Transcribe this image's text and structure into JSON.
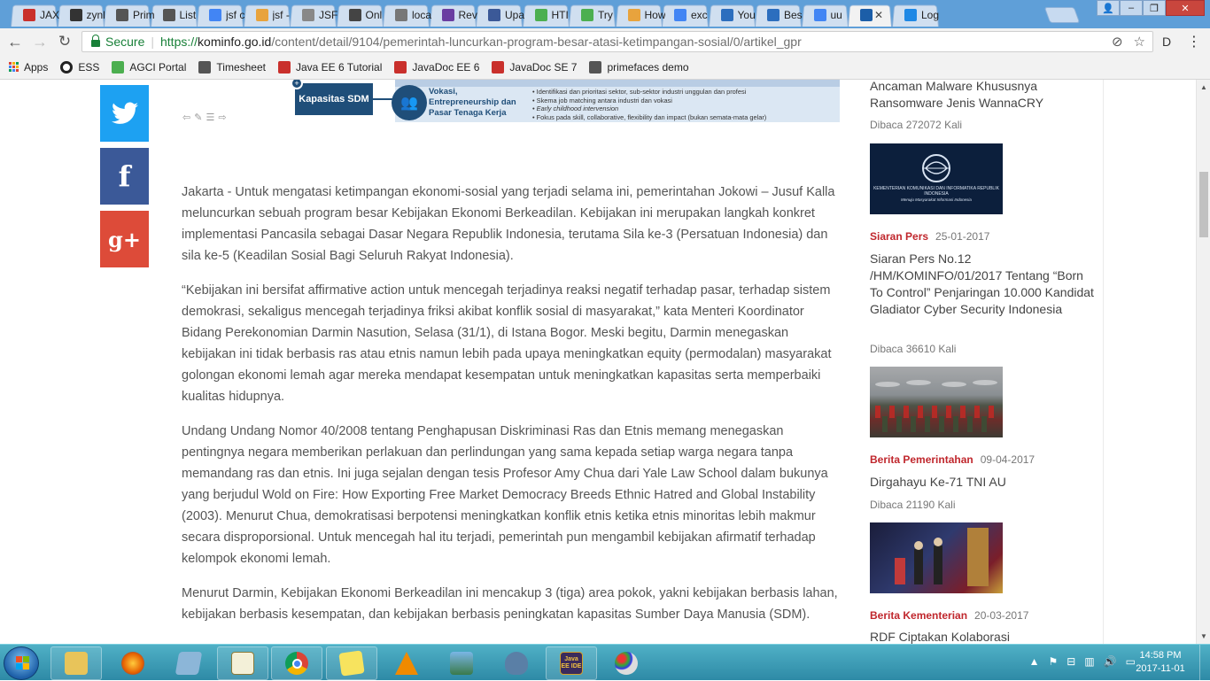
{
  "browser": {
    "tabs": [
      {
        "title": "JAX",
        "fav_color": "#c9302c",
        "icon": "oracle-icon"
      },
      {
        "title": "zynl",
        "fav_color": "#333333",
        "icon": "github-icon"
      },
      {
        "title": "Prim",
        "fav_color": "#555555",
        "icon": "primefaces-icon"
      },
      {
        "title": "List",
        "fav_color": "#555555",
        "icon": "wikipedia-icon"
      },
      {
        "title": "jsf c",
        "fav_color": "#4285f4",
        "icon": "google-icon"
      },
      {
        "title": "jsf -",
        "fav_color": "#e8a33d",
        "icon": "stackoverflow-icon"
      },
      {
        "title": "JSF",
        "fav_color": "#888888",
        "icon": "page-icon"
      },
      {
        "title": "Onl",
        "fav_color": "#444444",
        "icon": "mascot-icon"
      },
      {
        "title": "loca",
        "fav_color": "#777777",
        "icon": "document-icon"
      },
      {
        "title": "Rev",
        "fav_color": "#6a3ea1",
        "icon": "d-icon"
      },
      {
        "title": "Upa",
        "fav_color": "#3b5998",
        "icon": "facebook-icon"
      },
      {
        "title": "HTI",
        "fav_color": "#4caf50",
        "icon": "w3schools-icon"
      },
      {
        "title": "Try",
        "fav_color": "#4caf50",
        "icon": "w3schools-icon"
      },
      {
        "title": "How",
        "fav_color": "#e8a33d",
        "icon": "stackoverflow-icon"
      },
      {
        "title": "exc",
        "fav_color": "#4285f4",
        "icon": "google-icon"
      },
      {
        "title": "You",
        "fav_color": "#2c6ebe",
        "icon": "grid-icon"
      },
      {
        "title": "Bes",
        "fav_color": "#2c6ebe",
        "icon": "cb-icon"
      },
      {
        "title": "uu",
        "fav_color": "#4285f4",
        "icon": "google-icon"
      },
      {
        "title": "",
        "fav_color": "#1c5ea8",
        "icon": "kominfo-icon",
        "active": true
      },
      {
        "title": "Log",
        "fav_color": "#1e88e5",
        "icon": "r-icon"
      }
    ],
    "active_tab_close": "✕",
    "url": {
      "secure_label": "Secure",
      "scheme": "https://",
      "host": "kominfo.go.id",
      "path": "/content/detail/9104/pemerintah-luncurkan-program-besar-atasi-ketimpangan-sosial/0/artikel_gpr"
    },
    "bookmarks": [
      {
        "label": "Apps",
        "icon": "apps-grid-icon",
        "color": "#555555"
      },
      {
        "label": "ESS",
        "icon": "ess-icon",
        "color": "#222222"
      },
      {
        "label": "AGCI Portal",
        "icon": "agci-icon",
        "color": "#4caf50"
      },
      {
        "label": "Timesheet",
        "icon": "timesheet-icon",
        "color": "#555555"
      },
      {
        "label": "Java EE 6 Tutorial",
        "icon": "oracle-icon",
        "color": "#c9302c"
      },
      {
        "label": "JavaDoc EE 6",
        "icon": "oracle-icon",
        "color": "#c9302c"
      },
      {
        "label": "JavaDoc SE 7",
        "icon": "oracle-icon",
        "color": "#c9302c"
      },
      {
        "label": "primefaces demo",
        "icon": "primefaces-icon",
        "color": "#555555"
      }
    ]
  },
  "page": {
    "infographic": {
      "box_label": "Kapasitas SDM",
      "pillar_label": "Vokasi, Entrepreneurship dan Pasar Tenaga Kerja",
      "bullets": [
        "Identifikasi dan prioritasi sektor, sub-sektor industri unggulan dan profesi",
        "Skema job matching antara industri dan vokasi",
        "Early childhood intervension",
        "Fokus pada skill, collaborative, flexibility dan impact (bukan semata-mata gelar)"
      ]
    },
    "share": {
      "colors": {
        "twitter": "#1da1f2",
        "facebook": "#3b5998",
        "googleplus": "#dd4b39"
      },
      "gplus_text": "g+"
    },
    "article": {
      "paragraphs": [
        "Jakarta - Untuk mengatasi ketimpangan ekonomi-sosial yang terjadi selama ini, pemerintahan Jokowi – Jusuf Kalla meluncurkan sebuah program besar Kebijakan Ekonomi Berkeadilan. Kebijakan ini merupakan langkah konkret implementasi Pancasila sebagai Dasar Negara Republik Indonesia, terutama Sila ke-3 (Persatuan Indonesia) dan sila ke-5 (Keadilan Sosial Bagi Seluruh Rakyat Indonesia).",
        "“Kebijakan ini bersifat affirmative action untuk mencegah terjadinya reaksi negatif terhadap pasar, terhadap sistem demokrasi, sekaligus mencegah terjadinya friksi akibat konflik sosial di masyarakat,” kata Menteri Koordinator Bidang Perekonomian Darmin Nasution, Selasa (31/1), di Istana Bogor. Meski begitu, Darmin menegaskan kebijakan ini tidak berbasis ras atau etnis namun lebih pada upaya meningkatkan equity (permodalan) masyarakat golongan ekonomi lemah agar mereka mendapat kesempatan untuk meningkatkan kapasitas serta memperbaiki kualitas hidupnya.",
        "Undang Undang Nomor 40/2008 tentang Penghapusan Diskriminasi Ras dan Etnis memang menegaskan pentingnya negara memberikan perlakuan dan perlindungan yang sama kepada setiap warga negara tanpa memandang ras dan etnis. Ini juga sejalan dengan tesis Profesor Amy Chua dari Yale Law School dalam bukunya yang berjudul  Wold on Fire: How Exporting Free Market Democracy Breeds Ethnic Hatred and Global Instability (2003). Menurut Chua, demokratisasi berpotensi meningkatkan konflik etnis ketika etnis minoritas lebih makmur secara disproporsional. Untuk mencegah  hal itu terjadi, pemerintah pun mengambil kebijakan afirmatif terhadap kelompok ekonomi lemah.",
        "Menurut Darmin, Kebijakan Ekonomi Berkeadilan ini mencakup 3 (tiga) area pokok, yakni kebijakan berbasis lahan, kebijakan berbasis kesempatan, dan kebijakan berbasis peningkatan kapasitas Sumber Daya Manusia (SDM)."
      ]
    },
    "sidebar": {
      "items": [
        {
          "title": "Ancaman Malware Khususnya Ransomware Jenis WannaCRY",
          "views": "Dibaca 272072 Kali"
        },
        {
          "category": "Siaran Pers",
          "date": "25-01-2017",
          "title": "Siaran Pers No.12 /HM/KOMINFO/01/2017 Tentang “Born To Control” Penjaringan 10.000 Kandidat Gladiator Cyber Security Indonesia",
          "views": "Dibaca 36610 Kali",
          "thumb_caption": "KEMENTERIAN KOMUNIKASI DAN INFORMATIKA REPUBLIK INDONESIA",
          "thumb_tagline": "Menuju Masyarakat Informasi Indonesia"
        },
        {
          "category": "Berita Pemerintahan",
          "date": "09-04-2017",
          "title": "Dirgahayu Ke-71 TNI AU",
          "views": "Dibaca 21190 Kali"
        },
        {
          "category": "Berita Kementerian",
          "date": "20-03-2017",
          "title": "RDF Ciptakan Kolaborasi"
        }
      ]
    }
  },
  "taskbar": {
    "time": "14:58 PM",
    "date": "2017-11-01",
    "eclipse_label": "Java EE IDE"
  }
}
